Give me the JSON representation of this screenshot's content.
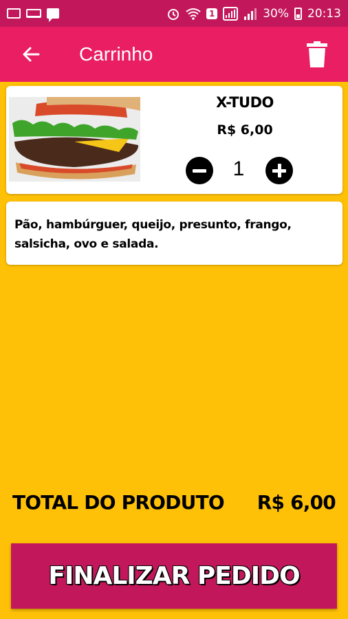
{
  "status_bar": {
    "battery_percent": "30%",
    "time": "20:13",
    "notification_badge": "1",
    "icons": [
      "gallery-icon",
      "laptop-icon",
      "chat-icon",
      "alarm-icon",
      "wifi-icon",
      "sim-icon",
      "signal-icon",
      "battery-icon"
    ]
  },
  "app_bar": {
    "title": "Carrinho",
    "back_icon": "arrow-left-icon",
    "trash_icon": "trash-icon"
  },
  "product": {
    "name": "X-TUDO",
    "price": "R$ 6,00",
    "quantity": "1",
    "description": "Pão, hambúrguer, queijo, presunto, frango, salsicha, ovo e salada."
  },
  "total": {
    "label": "TOTAL DO PRODUTO",
    "value": "R$ 6,00"
  },
  "finalize": {
    "label": "FINALIZAR PEDIDO"
  },
  "colors": {
    "background": "#FFC107",
    "app_bar": "#E91E63",
    "status_bar": "#C2185B",
    "button": "#C2185B"
  }
}
